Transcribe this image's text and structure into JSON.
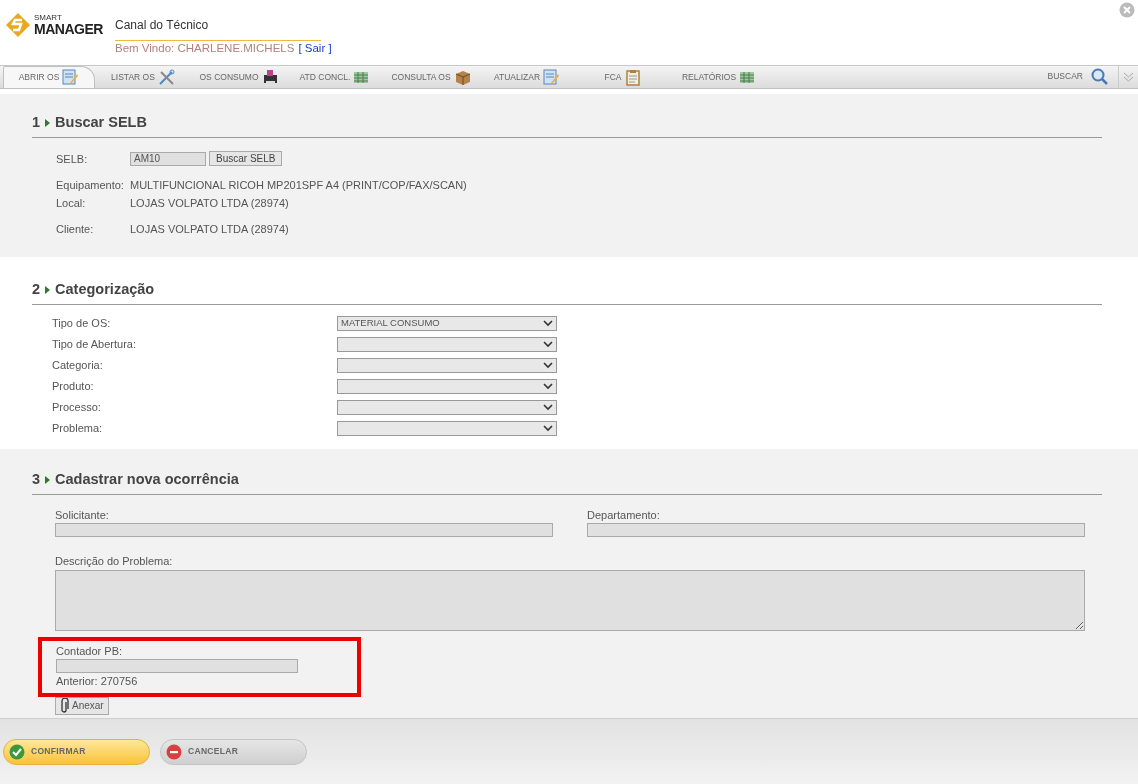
{
  "header": {
    "logo_small": "SMART",
    "logo_big": "MANAGER",
    "title": "Canal do Técnico",
    "welcome": "Bem Vindo: CHARLENE.MICHELS",
    "logout": "[ Sair ]"
  },
  "tabs": [
    {
      "label": "ABRIR OS",
      "selected": true
    },
    {
      "label": "LISTAR OS",
      "selected": false
    },
    {
      "label": "OS CONSUMO",
      "selected": false
    },
    {
      "label": "ATD CONCL.",
      "selected": false
    },
    {
      "label": "CONSULTA OS",
      "selected": false
    },
    {
      "label": "ATUALIZAR",
      "selected": false
    },
    {
      "label": "FCA",
      "selected": false
    },
    {
      "label": "RELATÓRIOS",
      "selected": false
    }
  ],
  "search": {
    "label": "BUSCAR"
  },
  "section_1": {
    "number": "1",
    "title": "Buscar SELB",
    "selb_label": "SELB:",
    "selb_value": "AM10",
    "search_button": "Buscar SELB",
    "info": [
      {
        "label": "Equipamento:",
        "value": "MULTIFUNCIONAL RICOH MP201SPF A4 (PRINT/COP/FAX/SCAN)"
      },
      {
        "label": "Local:",
        "value": "LOJAS VOLPATO LTDA (28974)"
      },
      {
        "label": "Cliente:",
        "value": "LOJAS VOLPATO LTDA (28974)"
      }
    ]
  },
  "section_2": {
    "number": "2",
    "title": "Categorização",
    "fields": [
      {
        "label": "Tipo de OS:",
        "value": "MATERIAL CONSUMO"
      },
      {
        "label": "Tipo de Abertura:"
      },
      {
        "label": "Categoria:"
      },
      {
        "label": "Produto:"
      },
      {
        "label": "Processo:"
      },
      {
        "label": "Problema:"
      }
    ]
  },
  "section_3": {
    "number": "3",
    "title": "Cadastrar nova ocorrência",
    "requester_label": "Solicitante:",
    "department_label": "Departamento:",
    "description_label": "Descrição do Problema:",
    "counter": {
      "label": "Contador PB:",
      "previous": "Anterior: 270756",
      "highlighted": true
    },
    "attach_button": "Anexar"
  },
  "footer_buttons": [
    {
      "label": "CONFIRMAR",
      "kind": "confirm"
    },
    {
      "label": "CANCELAR",
      "kind": "cancel"
    }
  ]
}
